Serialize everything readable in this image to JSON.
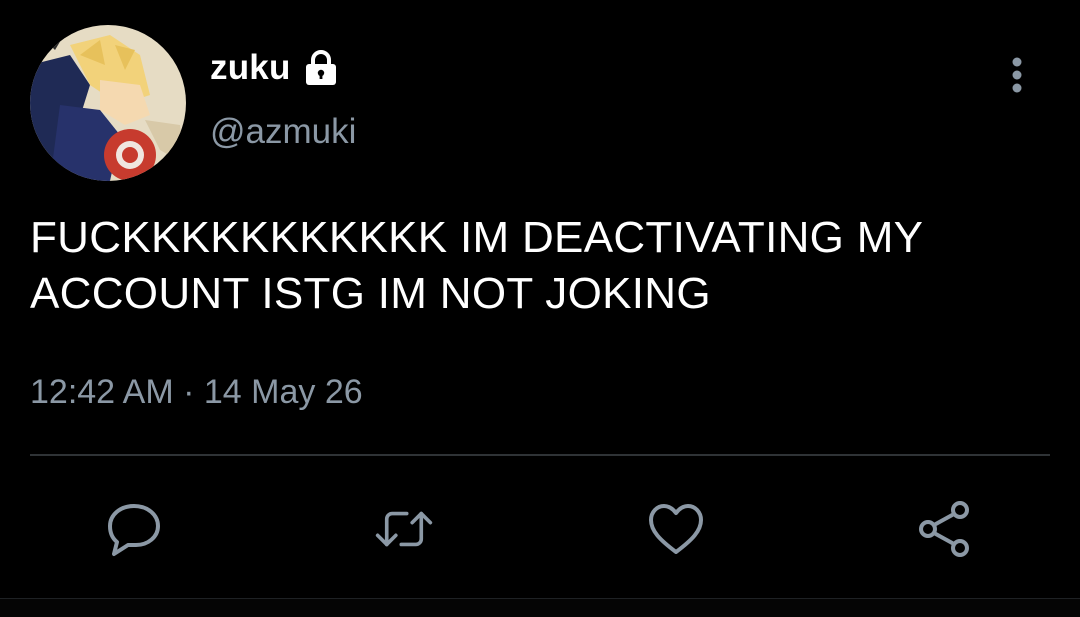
{
  "user": {
    "display_name": "zuku",
    "handle": "@azmuki",
    "protected_icon": "lock-icon",
    "avatar_icon": "avatar-illustration"
  },
  "tweet": {
    "text": "FUCKKKKKKKKKKK IM DEACTIVATING MY ACCOUNT ISTG IM NOT JOKING",
    "time": "12:42 AM",
    "separator": "·",
    "date": "14 May 26"
  },
  "actions": [
    {
      "icon": "reply-icon"
    },
    {
      "icon": "retweet-icon"
    },
    {
      "icon": "like-icon"
    },
    {
      "icon": "share-icon"
    }
  ],
  "menu": {
    "icon": "more-vertical-icon"
  },
  "colors": {
    "background": "#000000",
    "text_primary": "#ffffff",
    "text_secondary": "#8b98a5",
    "divider": "#2f3336"
  }
}
